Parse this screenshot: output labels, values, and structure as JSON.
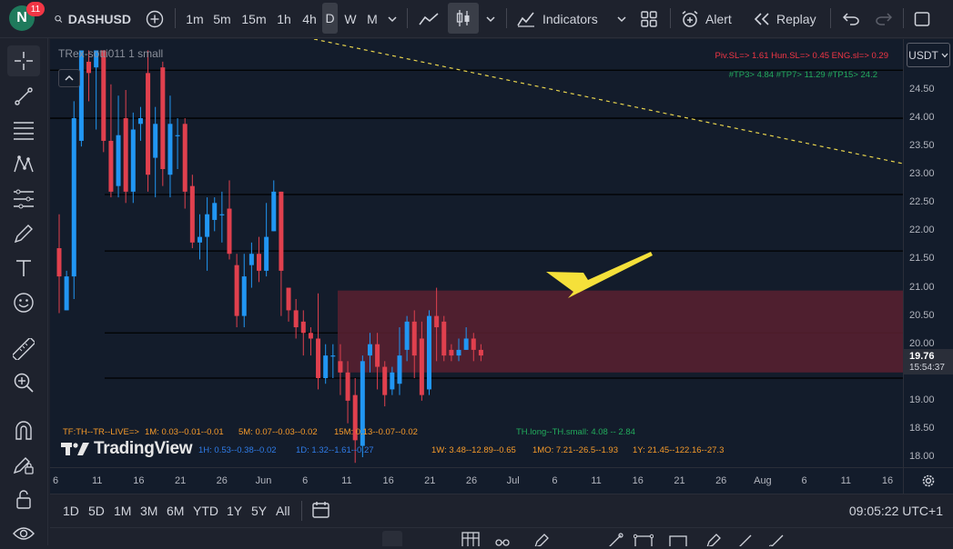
{
  "topbar": {
    "avatar_letter": "N",
    "notification_count": "11",
    "symbol": "DASHUSD",
    "intervals": [
      "1m",
      "5m",
      "15m",
      "1h",
      "4h",
      "D",
      "W",
      "M"
    ],
    "active_interval": "D",
    "indicators_label": "Indicators",
    "alert_label": "Alert",
    "replay_label": "Replay"
  },
  "chart": {
    "indicator_title": "TRex-sotti011 1 small",
    "info_line_1": "Piv.SL=> 1.61  Hun.SL=> 0.45  ENG.sl=> 0.29",
    "info_line_2": "#TP3> 4.84  #TP7> 11.29  #TP15> 24.2",
    "bottom_line_tf": "TF:TH--TR--LIVE=>",
    "bottom_line_1m": "1M: 0.03--0.01--0.01",
    "bottom_line_5m": "5M: 0.07--0.03--0.02",
    "bottom_line_15m": "15M: 0.13--0.07--0.02",
    "bottom_line_1h": "1H: 0.53--0.38--0.02",
    "bottom_line_1d": "1D: 1.32--1.61--0.27",
    "bottom_line_th": "TH.long--TH.small: 4.08 -- 2.84",
    "bottom_line_1w": "1W: 3.48--12.89--0.65",
    "bottom_line_1mo": "1MO: 7.21--26.5--1.93",
    "bottom_line_1y": "1Y: 21.45--122.16--27.3",
    "watermark": "TradingView"
  },
  "price_axis": {
    "currency": "USDT",
    "ticks": [
      "24.50",
      "24.00",
      "23.50",
      "23.00",
      "22.50",
      "22.00",
      "21.50",
      "21.00",
      "20.50",
      "20.00",
      "19.50",
      "19.00",
      "18.50",
      "18.00"
    ],
    "last_price": "19.76",
    "countdown": "15:54:37"
  },
  "time_axis": {
    "ticks": [
      "6",
      "11",
      "16",
      "21",
      "26",
      "Jun",
      "6",
      "11",
      "16",
      "21",
      "26",
      "Jul",
      "6",
      "11",
      "16",
      "21",
      "26",
      "Aug",
      "6",
      "11",
      "16"
    ]
  },
  "bottombar": {
    "ranges": [
      "1D",
      "5D",
      "1M",
      "3M",
      "6M",
      "YTD",
      "1Y",
      "5Y",
      "All"
    ],
    "clock": "09:05:22 UTC+1"
  },
  "colors": {
    "up": "#2196f3",
    "down": "#e0404e",
    "zone": "#5a2030",
    "arrow": "#f5e03a",
    "trendline": "#e8d44d"
  },
  "chart_data": {
    "type": "candlestick",
    "timeframe": "D",
    "ylim": [
      17.9,
      25.2
    ],
    "horizontal_levels": [
      24.85,
      24.0,
      22.65,
      21.65,
      20.2,
      19.4
    ],
    "zone": [
      19.5,
      20.95
    ],
    "candles": [
      [
        21.7,
        21.2,
        20.55,
        22.3
      ],
      [
        20.6,
        21.2,
        20.6,
        21.3
      ],
      [
        21.2,
        24.0,
        20.8,
        24.3
      ],
      [
        23.6,
        25.2,
        23.5,
        25.2
      ],
      [
        25.0,
        24.8,
        24.3,
        25.2
      ],
      [
        24.9,
        25.2,
        23.8,
        25.2
      ],
      [
        25.2,
        23.6,
        23.4,
        25.2
      ],
      [
        23.6,
        22.7,
        22.6,
        24.6
      ],
      [
        22.8,
        23.7,
        22.6,
        24.4
      ],
      [
        24.0,
        22.7,
        22.5,
        24.5
      ],
      [
        22.7,
        23.8,
        22.5,
        24.1
      ],
      [
        23.9,
        24.0,
        23.6,
        24.2
      ],
      [
        24.8,
        23.0,
        22.7,
        25.2
      ],
      [
        23.3,
        23.9,
        22.6,
        24.2
      ],
      [
        24.9,
        23.1,
        22.8,
        25.0
      ],
      [
        23.0,
        23.9,
        22.6,
        24.4
      ],
      [
        23.7,
        23.7,
        23.1,
        24.0
      ],
      [
        23.9,
        22.7,
        22.4,
        24.0
      ],
      [
        22.8,
        21.8,
        21.7,
        23.0
      ],
      [
        21.8,
        21.9,
        21.5,
        22.3
      ],
      [
        21.9,
        22.3,
        21.3,
        22.6
      ],
      [
        22.2,
        22.5,
        22.0,
        22.6
      ],
      [
        22.3,
        22.3,
        21.8,
        22.7
      ],
      [
        22.4,
        21.6,
        21.5,
        22.9
      ],
      [
        21.4,
        20.5,
        20.3,
        21.6
      ],
      [
        20.5,
        21.2,
        20.3,
        21.6
      ],
      [
        21.4,
        21.6,
        21.0,
        21.8
      ],
      [
        21.6,
        21.3,
        21.1,
        21.9
      ],
      [
        21.3,
        21.9,
        21.2,
        22.5
      ],
      [
        22.0,
        22.7,
        22.0,
        22.9
      ],
      [
        22.7,
        21.3,
        20.5,
        22.7
      ],
      [
        21.0,
        20.6,
        20.4,
        21.0
      ],
      [
        20.6,
        20.3,
        20.1,
        20.8
      ],
      [
        20.4,
        20.2,
        19.8,
        20.6
      ],
      [
        20.2,
        20.1,
        19.8,
        20.3
      ],
      [
        20.1,
        19.4,
        19.2,
        20.9
      ],
      [
        19.4,
        19.8,
        19.3,
        20.0
      ],
      [
        19.8,
        19.8,
        19.4,
        20.0
      ],
      [
        19.7,
        19.5,
        19.1,
        20.0
      ],
      [
        19.5,
        19.0,
        18.6,
        19.7
      ],
      [
        19.1,
        18.3,
        17.9,
        19.4
      ],
      [
        18.2,
        19.7,
        18.0,
        19.8
      ],
      [
        19.8,
        20.0,
        19.5,
        20.2
      ],
      [
        20.0,
        19.6,
        19.2,
        20.2
      ],
      [
        19.6,
        19.1,
        18.9,
        19.7
      ],
      [
        19.2,
        19.5,
        19.1,
        19.6
      ],
      [
        19.3,
        19.8,
        19.1,
        20.3
      ],
      [
        19.9,
        20.4,
        19.7,
        20.5
      ],
      [
        20.4,
        19.8,
        19.4,
        20.6
      ],
      [
        20.1,
        19.1,
        19.0,
        20.4
      ],
      [
        19.2,
        20.5,
        19.1,
        20.6
      ],
      [
        20.5,
        20.3,
        19.7,
        21.0
      ],
      [
        20.4,
        19.8,
        19.7,
        20.5
      ],
      [
        19.9,
        19.8,
        19.7,
        20.0
      ],
      [
        19.8,
        19.9,
        19.7,
        20.1
      ],
      [
        19.9,
        20.1,
        19.9,
        20.3
      ],
      [
        20.1,
        19.9,
        19.7,
        20.2
      ],
      [
        19.9,
        19.8,
        19.7,
        20.0
      ]
    ]
  }
}
